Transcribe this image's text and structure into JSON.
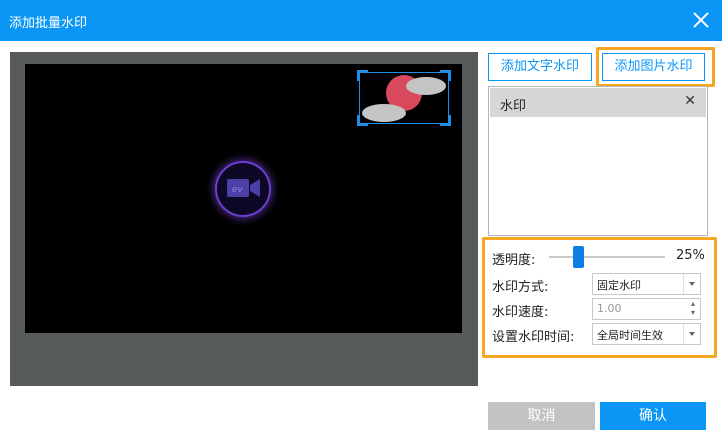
{
  "dialog": {
    "title": "添加批量水印"
  },
  "buttons": {
    "add_text_watermark": "添加文字水印",
    "add_image_watermark": "添加图片水印",
    "cancel": "取消",
    "confirm": "确认"
  },
  "watermark_list": {
    "items": [
      {
        "label": "水印",
        "remove": "✕"
      }
    ]
  },
  "settings": {
    "opacity_label": "透明度:",
    "opacity_value": "25%",
    "opacity_fraction": 0.25,
    "mode_label": "水印方式:",
    "mode_value": "固定水印",
    "speed_label": "水印速度:",
    "speed_value": "1.00",
    "time_label": "设置水印时间:",
    "time_value": "全局时间生效"
  },
  "colors": {
    "accent": "#0b96f5",
    "highlight": "#f5a623",
    "cancel_bg": "#c3c3c3"
  },
  "icons": [
    "close-icon",
    "video-camera-icon",
    "chevron-down-icon",
    "spinner-arrows-icon"
  ]
}
